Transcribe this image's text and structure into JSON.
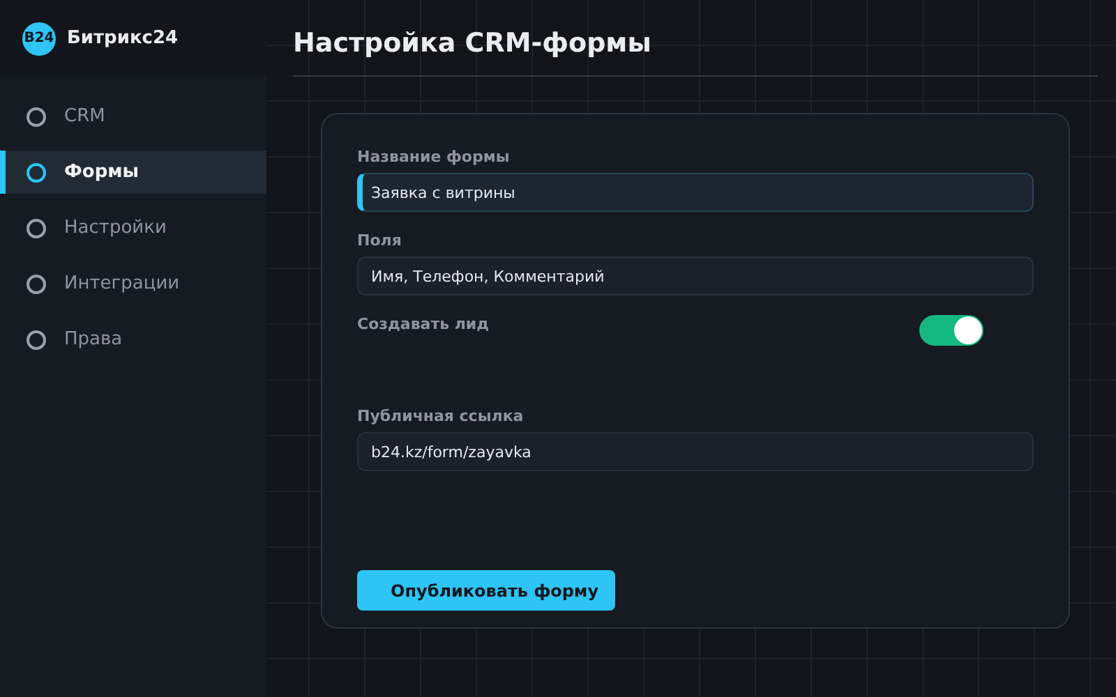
{
  "sidebar": {
    "logo": {
      "mark": "B24",
      "name": "Битрикс24"
    },
    "items": [
      {
        "label": "CRM",
        "selected": false
      },
      {
        "label": "Формы",
        "selected": true
      },
      {
        "label": "Настройки",
        "selected": false
      },
      {
        "label": "Интеграции",
        "selected": false
      },
      {
        "label": "Права",
        "selected": false
      }
    ]
  },
  "page": {
    "title": "Настройка CRM-формы"
  },
  "form": {
    "fields": [
      {
        "kind": "text",
        "label": "Название формы",
        "value": "Заявка с витрины",
        "focused": true
      },
      {
        "kind": "text",
        "label": "Поля",
        "value": "Имя, Телефон, Комментарий",
        "focused": false
      },
      {
        "kind": "toggle",
        "label": "Создавать лид",
        "on": true
      },
      {
        "kind": "text",
        "label": "Публичная ссылка",
        "value": "b24.kz/form/zayavka",
        "focused": false
      }
    ],
    "submit": "Опубликовать форму"
  }
}
